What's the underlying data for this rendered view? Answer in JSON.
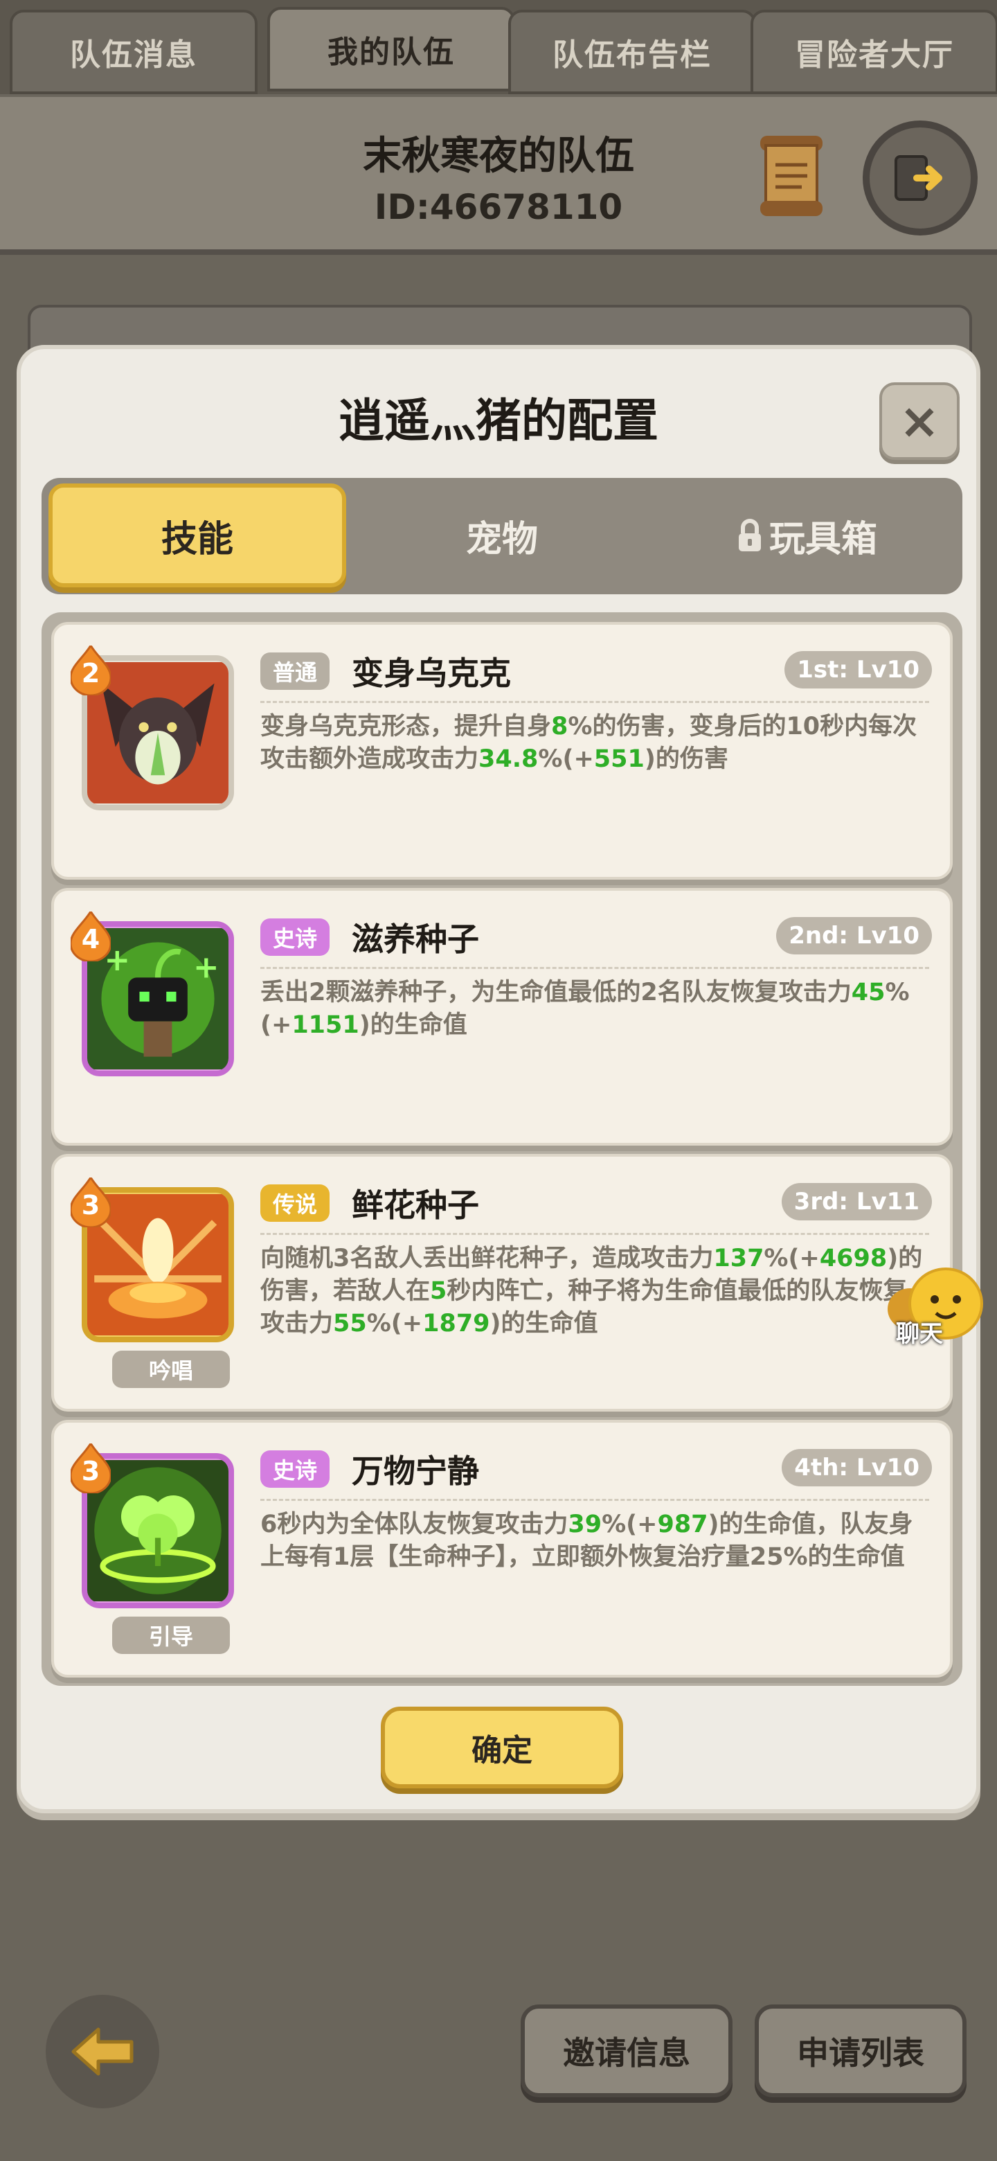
{
  "top_tabs": [
    {
      "label": "队伍消息"
    },
    {
      "label": "我的队伍"
    },
    {
      "label": "队伍布告栏"
    },
    {
      "label": "冒险者大厅"
    }
  ],
  "team": {
    "name": "末秋寒夜的队伍",
    "id": "ID:46678110"
  },
  "modal": {
    "title": "逍遥灬猪的配置",
    "close_label": "×",
    "tabs": [
      {
        "label": "技能"
      },
      {
        "label": "宠物"
      },
      {
        "label": "玩具箱",
        "icon": "lock-icon"
      }
    ],
    "confirm_label": "确定"
  },
  "skills": [
    {
      "badge": "2",
      "rarity": "普通",
      "name": "变身乌克克",
      "order": "1st: Lv10",
      "desc": [
        "变身乌克克形态，提升自身",
        "8",
        "%的伤害，变身后的10秒内每次攻击额外造成攻击力",
        "34.8",
        "%(+",
        "551",
        ")的伤害"
      ],
      "cast_type": ""
    },
    {
      "badge": "4",
      "rarity": "史诗",
      "name": "滋养种子",
      "order": "2nd: Lv10",
      "desc": [
        "丢出2颗滋养种子，为生命值最低的2名队友恢复攻击力",
        "45",
        "%(+",
        "1151",
        ")的生命值"
      ],
      "cast_type": ""
    },
    {
      "badge": "3",
      "rarity": "传说",
      "name": "鲜花种子",
      "order": "3rd: Lv11",
      "desc": [
        "向随机3名敌人丢出鲜花种子，造成攻击力",
        "137",
        "%(+",
        "4698",
        ")的伤害，若敌人在",
        "5",
        "秒内阵亡，种子将为生命值最低的队友恢复攻击力",
        "55",
        "%(+",
        "1879",
        ")的生命值"
      ],
      "cast_type": "吟唱"
    },
    {
      "badge": "3",
      "rarity": "史诗",
      "name": "万物宁静",
      "order": "4th: Lv10",
      "desc": [
        "6秒内为全体队友恢复攻击力",
        "39",
        "%(+",
        "987",
        ")的生命值，队友身上每有1层【生命种子】，立即额外恢复治疗量25%的生命值"
      ],
      "cast_type": "引导"
    }
  ],
  "chat": {
    "label": "聊天"
  },
  "bottom": {
    "invite_label": "邀请信息",
    "apply_label": "申请列表"
  },
  "colors": {
    "accent_yellow": "#f6d56a",
    "epic_purple": "#d47ee0",
    "legend_gold": "#e8b52e",
    "value_green": "#2eae27"
  }
}
